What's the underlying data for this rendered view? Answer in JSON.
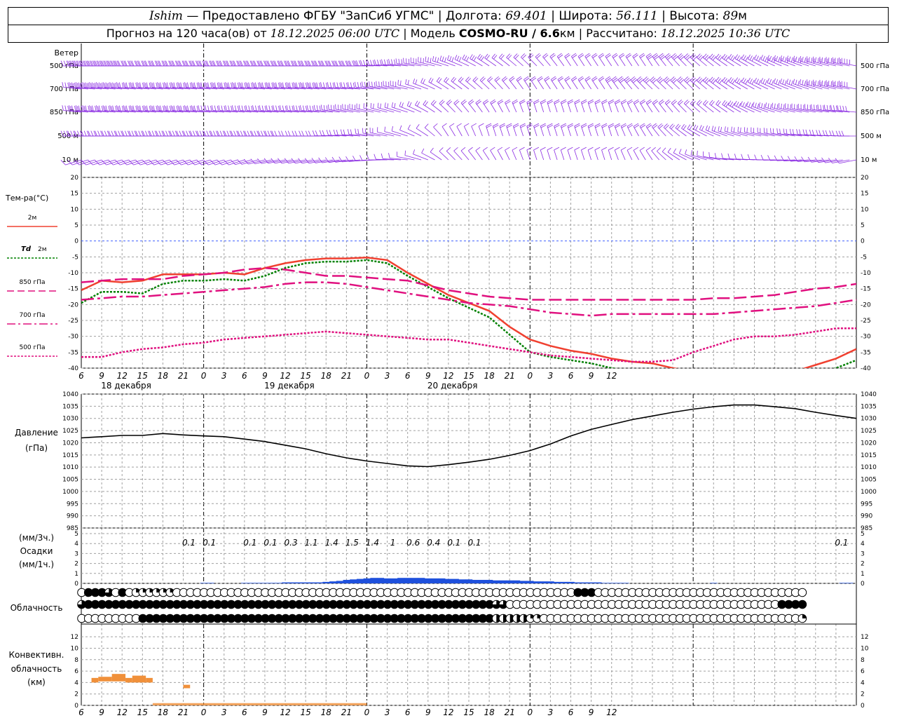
{
  "header": {
    "station": "Ishim",
    "provider": "— Предоставлено ФГБУ \"ЗапСиб УГМС\"",
    "lon_label": "| Долгота:",
    "lon": "69.401",
    "lat_label": "| Широта:",
    "lat": "56.111",
    "alt_label": "| Высота:",
    "alt": "89",
    "alt_unit": "м",
    "fc_label": "Прогноз на 120 часа(ов) от",
    "fc_time": "18.12.2025 06:00 UTC",
    "model_label": "| Модель",
    "model": "COSMO-RU / 6.6",
    "model_unit": "км",
    "calc_label": "| Рассчитано:",
    "calc_time": "18.12.2025 10:36 UTC"
  },
  "colors": {
    "wind": "#8a2be2",
    "t2m": "#f04030",
    "td2m": "#008000",
    "t850": "#e0107f",
    "t700": "#e0107f",
    "t500": "#e0107f",
    "pressure": "#000000",
    "precip": "#1e50dc",
    "conv": "#f0903a",
    "zero_line": "#4060ff",
    "grid": "#a0a0a0"
  },
  "labels": {
    "wind_title": "Ветер",
    "wind_levels": [
      "500 гПа",
      "700 гПа",
      "850 гПа",
      "500 м",
      "10 м"
    ],
    "temp_title": "Тем-ра(°C)",
    "legend_t2m": "2м",
    "legend_td": "Td",
    "legend_td_suffix": "2м",
    "legend_850": "850 гПа",
    "legend_700": "700 гПа",
    "legend_500": "500 гПа",
    "press_title": "Давление",
    "press_unit": "(гПа)",
    "precip_unit3": "(мм/3ч.)",
    "precip_title": "Осадки",
    "precip_unit1": "(мм/1ч.)",
    "cloud_title": "Облачность",
    "conv_title1": "Конвективн.",
    "conv_title2": "облачность",
    "conv_unit": "(км)"
  },
  "chart_data": {
    "x_hours_from_start": [
      0,
      114
    ],
    "time_ticks": [
      "6",
      "9",
      "12",
      "15",
      "18",
      "21",
      "0",
      "3",
      "6",
      "9",
      "12",
      "15",
      "18",
      "21",
      "0",
      "3",
      "6",
      "9",
      "12",
      "15",
      "18",
      "21",
      "0",
      "3",
      "6",
      "9",
      "12"
    ],
    "days": [
      {
        "label": "18 декабря",
        "hour": 6.6
      },
      {
        "label": "19 декабря",
        "hour": 30.6
      },
      {
        "label": "20 декабря",
        "hour": 54.6
      }
    ],
    "temperature": {
      "type": "line",
      "ylim": [
        -40,
        20
      ],
      "yticks": [
        -40,
        -35,
        -30,
        -25,
        -20,
        -15,
        -10,
        -5,
        0,
        5,
        10,
        15,
        20
      ],
      "x": [
        0,
        3,
        6,
        9,
        12,
        15,
        18,
        21,
        24,
        27,
        30,
        33,
        36,
        39,
        42,
        45,
        48,
        51,
        54,
        57,
        60,
        63,
        66,
        69,
        72,
        75,
        78,
        81,
        84,
        87,
        90,
        93,
        96,
        99,
        102,
        105,
        108,
        111,
        114
      ],
      "series": [
        {
          "name": "2м",
          "style": "solid",
          "values": [
            -15.5,
            -12.5,
            -13,
            -12.5,
            -10.5,
            -10.5,
            -10.5,
            -10,
            -10.5,
            -8.5,
            -7,
            -6,
            -5.5,
            -5.5,
            -5.2,
            -6,
            -10,
            -13.5,
            -17,
            -19.5,
            -22,
            -27,
            -31,
            -33,
            -34.5,
            -35.5,
            -37,
            -38,
            -38.5,
            -40,
            -41,
            -42,
            -42,
            -41.5,
            -42,
            -41,
            -39,
            -37,
            -34
          ]
        },
        {
          "name": "Td 2м",
          "style": "dotted",
          "values": [
            -19.5,
            -16,
            -16,
            -16.5,
            -13.5,
            -12.5,
            -12.5,
            -12,
            -12.5,
            -11,
            -8.5,
            -7,
            -6.5,
            -6.5,
            -6,
            -7,
            -11,
            -14.5,
            -18,
            -21,
            -24,
            -29.5,
            -35,
            -36.5,
            -37.5,
            -38.5,
            -40,
            -41,
            -41.5,
            -43,
            -44,
            -45,
            -45,
            -44.5,
            -45,
            -44,
            -42,
            -40,
            -37.5
          ]
        },
        {
          "name": "850 гПа",
          "style": "dashed",
          "values": [
            -13,
            -12.5,
            -12,
            -12,
            -12,
            -11,
            -10.5,
            -10,
            -9,
            -8.5,
            -9,
            -10,
            -11,
            -11,
            -11.5,
            -12,
            -12.5,
            -14,
            -15.5,
            -16.5,
            -17.5,
            -18,
            -18.5,
            -18.5,
            -18.5,
            -18.5,
            -18.5,
            -18.5,
            -18.5,
            -18.5,
            -18.5,
            -18,
            -18,
            -17.5,
            -17,
            -16,
            -15,
            -14.5,
            -13.5
          ]
        },
        {
          "name": "700 гПа",
          "style": "dashdot",
          "values": [
            -18.5,
            -18,
            -17.5,
            -17.5,
            -17,
            -16.5,
            -16,
            -15.5,
            -15,
            -14.5,
            -13.5,
            -13,
            -13,
            -13.5,
            -14.5,
            -15.5,
            -16.5,
            -17.5,
            -18.5,
            -19.5,
            -20,
            -20.5,
            -21.5,
            -22.5,
            -23,
            -23.5,
            -23,
            -23,
            -23,
            -23,
            -23,
            -23,
            -22.5,
            -22,
            -21.5,
            -21,
            -20.5,
            -19.5,
            -18.5
          ]
        },
        {
          "name": "500 гПа",
          "style": "dotted",
          "values": [
            -36.5,
            -36.5,
            -35,
            -34,
            -33.5,
            -32.5,
            -32,
            -31,
            -30.5,
            -30,
            -29.5,
            -29,
            -28.5,
            -29,
            -29.5,
            -30,
            -30.5,
            -31,
            -31,
            -32,
            -33,
            -34,
            -35,
            -36,
            -36.5,
            -37,
            -37.5,
            -38,
            -38,
            -37.5,
            -35,
            -33,
            -31,
            -30,
            -30,
            -29.5,
            -28.5,
            -27.5,
            -27.5
          ]
        }
      ]
    },
    "pressure": {
      "type": "line",
      "ylim": [
        985,
        1040
      ],
      "yticks": [
        985,
        990,
        995,
        1000,
        1005,
        1010,
        1015,
        1020,
        1025,
        1030,
        1035,
        1040
      ],
      "x": [
        0,
        3,
        6,
        9,
        12,
        15,
        18,
        21,
        24,
        27,
        30,
        33,
        36,
        39,
        42,
        45,
        48,
        51,
        54,
        57,
        60,
        63,
        66,
        69,
        72,
        75,
        78,
        81,
        84,
        87,
        90,
        93,
        96,
        99,
        102,
        105,
        108,
        111,
        114
      ],
      "values": [
        1022,
        1022.5,
        1023,
        1023,
        1023.8,
        1023.2,
        1022.8,
        1022.5,
        1021.5,
        1020.5,
        1019,
        1017.5,
        1015.5,
        1013.8,
        1012.5,
        1011.5,
        1010.5,
        1010.2,
        1011,
        1012,
        1013.2,
        1014.8,
        1016.8,
        1019.5,
        1022.8,
        1025.5,
        1027.5,
        1029.5,
        1031,
        1032.5,
        1033.8,
        1034.8,
        1035.5,
        1035.5,
        1034.8,
        1034,
        1032.5,
        1031.2,
        1030
      ]
    },
    "precipitation": {
      "type": "bar",
      "ylim": [
        0,
        5
      ],
      "yticks": [
        0,
        1,
        2,
        3,
        4,
        5
      ],
      "hourly_x": [
        15,
        16,
        17,
        18,
        19,
        20,
        21,
        22,
        23,
        24,
        25,
        26,
        27,
        28,
        29,
        30,
        31,
        32,
        33,
        34,
        35,
        36,
        37,
        38,
        39,
        40,
        41,
        42,
        43,
        44,
        45,
        46,
        47,
        48,
        49,
        50,
        51,
        52,
        53,
        54,
        55,
        56,
        57,
        58,
        59,
        60,
        61,
        62,
        63,
        64,
        65,
        66,
        67,
        68,
        69,
        70,
        71,
        72,
        73,
        74,
        75,
        76,
        77,
        78,
        79,
        80,
        81,
        82,
        83,
        84,
        85,
        86,
        87,
        88,
        89,
        90,
        91,
        92,
        93,
        94,
        95,
        96,
        97,
        98,
        99,
        100,
        101,
        102,
        103,
        104,
        105,
        106,
        107,
        108,
        109,
        110,
        111,
        112,
        113,
        114
      ],
      "hourly_values": [
        0,
        0,
        0,
        0.05,
        0.05,
        0,
        0,
        0,
        0,
        0.05,
        0.05,
        0.05,
        0.05,
        0.05,
        0.05,
        0.1,
        0.1,
        0.1,
        0.1,
        0.1,
        0.1,
        0.15,
        0.2,
        0.25,
        0.35,
        0.4,
        0.45,
        0.5,
        0.55,
        0.55,
        0.5,
        0.5,
        0.55,
        0.55,
        0.55,
        0.55,
        0.5,
        0.5,
        0.5,
        0.45,
        0.45,
        0.4,
        0.4,
        0.35,
        0.35,
        0.35,
        0.3,
        0.3,
        0.3,
        0.3,
        0.25,
        0.25,
        0.2,
        0.2,
        0.2,
        0.15,
        0.15,
        0.15,
        0.1,
        0.1,
        0.1,
        0.1,
        0.05,
        0.05,
        0.05,
        0.05,
        0,
        0,
        0,
        0,
        0,
        0,
        0,
        0,
        0,
        0,
        0,
        0,
        0.05,
        0,
        0,
        0,
        0,
        0,
        0,
        0,
        0,
        0,
        0,
        0,
        0,
        0,
        0,
        0,
        0,
        0,
        0,
        0.05,
        0.05,
        0
      ],
      "three_hour_labels": [
        {
          "hour": 15,
          "value": "0.1"
        },
        {
          "hour": 18,
          "value": "0.1"
        },
        {
          "hour": 24,
          "value": "0.1"
        },
        {
          "hour": 27,
          "value": "0.1"
        },
        {
          "hour": 30,
          "value": "0.3"
        },
        {
          "hour": 33,
          "value": "1.1"
        },
        {
          "hour": 36,
          "value": "1.4"
        },
        {
          "hour": 39,
          "value": "1.5"
        },
        {
          "hour": 42,
          "value": "1.4"
        },
        {
          "hour": 45,
          "value": "1"
        },
        {
          "hour": 48,
          "value": "0.6"
        },
        {
          "hour": 51,
          "value": "0.4"
        },
        {
          "hour": 54,
          "value": "0.1"
        },
        {
          "hour": 57,
          "value": "0.1"
        },
        {
          "hour": 111,
          "value": "0.1"
        }
      ]
    },
    "cloudiness": {
      "type": "table",
      "legend": "0 = clear, 4 = overcast (quarters filled), one symbol per hour",
      "rows": [
        "04443040111111000000000000000000000000000000000000000000000000000000000004440000000000000000000000000000000",
        "34444444444444444444444444444444444444444444444444444444444443300000000000000000000000000000000000000004444",
        "00000000044444444444444444444444444444444444444444444444444442222211000000000000000000000000000000000000001"
      ]
    },
    "convective_cloud": {
      "type": "bar",
      "ylim": [
        0,
        13
      ],
      "yticks": [
        0,
        2,
        4,
        6,
        8,
        10,
        12
      ],
      "bars": [
        {
          "from": 1.5,
          "to": 2.5,
          "bottom": 4.0,
          "top": 4.8
        },
        {
          "from": 2.5,
          "to": 4.5,
          "bottom": 4.2,
          "top": 5.0
        },
        {
          "from": 4.5,
          "to": 6.5,
          "bottom": 4.2,
          "top": 5.5
        },
        {
          "from": 6.5,
          "to": 7.5,
          "bottom": 4.0,
          "top": 4.8
        },
        {
          "from": 7.5,
          "to": 9.5,
          "bottom": 4.0,
          "top": 5.2
        },
        {
          "from": 9.5,
          "to": 10.5,
          "bottom": 4.0,
          "top": 4.8
        },
        {
          "from": 15.0,
          "to": 16.0,
          "bottom": 3.0,
          "top": 3.6
        }
      ],
      "low_band": {
        "from": 10.5,
        "to": 42,
        "top": 0.4
      }
    },
    "wind": {
      "description": "wind barbs at 500 гПа, 700 гПа, 850 гПа, 500 м, 10 м; westerly ~30-40 m/s aloft first 2 days, turning northerly later",
      "levels": [
        "500 гПа",
        "700 гПа",
        "850 гПа",
        "500 м",
        "10 м"
      ],
      "hours": [
        0,
        6,
        12,
        18,
        24,
        30,
        36,
        42,
        48,
        54,
        60,
        66,
        72,
        78,
        84,
        90,
        96,
        102,
        108,
        114
      ],
      "speed_kt": [
        [
          45,
          45,
          40,
          40,
          40,
          35,
          35,
          35,
          30,
          25,
          25,
          20,
          20,
          20,
          25,
          25,
          30,
          35,
          40,
          45
        ],
        [
          45,
          45,
          40,
          40,
          35,
          35,
          35,
          30,
          25,
          20,
          20,
          20,
          20,
          25,
          25,
          25,
          30,
          30,
          35,
          40
        ],
        [
          40,
          40,
          40,
          35,
          30,
          30,
          30,
          25,
          20,
          15,
          15,
          15,
          15,
          15,
          20,
          20,
          25,
          25,
          30,
          35
        ],
        [
          30,
          30,
          30,
          25,
          25,
          25,
          20,
          20,
          10,
          10,
          15,
          15,
          15,
          15,
          15,
          15,
          15,
          20,
          20,
          25
        ],
        [
          10,
          10,
          10,
          10,
          10,
          10,
          10,
          5,
          5,
          10,
          10,
          10,
          10,
          10,
          10,
          10,
          5,
          10,
          10,
          10
        ]
      ],
      "dir_deg": [
        [
          270,
          270,
          270,
          270,
          270,
          270,
          270,
          270,
          280,
          300,
          320,
          330,
          340,
          340,
          340,
          330,
          320,
          310,
          300,
          290
        ],
        [
          280,
          280,
          280,
          280,
          280,
          280,
          280,
          280,
          290,
          320,
          330,
          340,
          340,
          340,
          330,
          330,
          320,
          310,
          300,
          290
        ],
        [
          280,
          280,
          280,
          280,
          280,
          280,
          280,
          290,
          300,
          330,
          340,
          350,
          350,
          350,
          340,
          330,
          320,
          300,
          290,
          280
        ],
        [
          270,
          270,
          270,
          270,
          270,
          270,
          270,
          280,
          300,
          340,
          350,
          350,
          350,
          350,
          340,
          320,
          300,
          290,
          280,
          270
        ],
        [
          240,
          240,
          240,
          240,
          240,
          250,
          250,
          260,
          280,
          330,
          340,
          350,
          350,
          350,
          340,
          310,
          280,
          270,
          260,
          250
        ]
      ]
    }
  }
}
